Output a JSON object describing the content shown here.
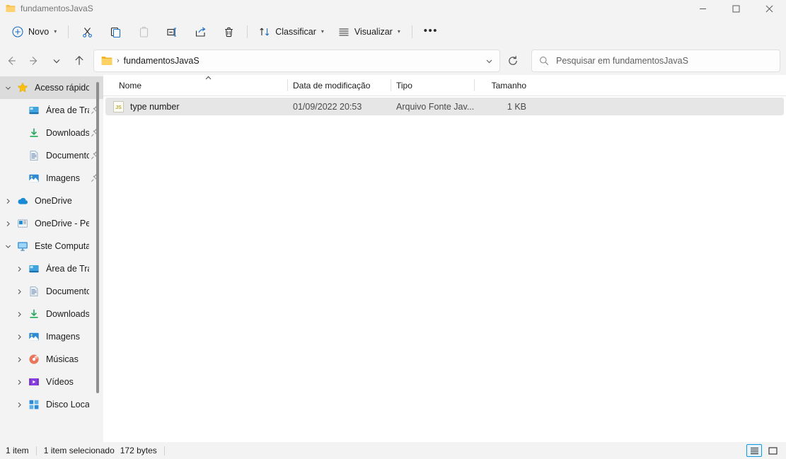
{
  "window": {
    "tab_title": "fundamentosJavaS",
    "tab_icon": "folder-icon",
    "minimize_label": "—",
    "maximize_label": "☐",
    "close_label": "✕"
  },
  "toolbar": {
    "new_label": "Novo",
    "new_icon": "plus-circle-icon",
    "cut_icon": "scissors-icon",
    "copy_icon": "copy-icon",
    "paste_icon": "paste-icon",
    "rename_icon": "rename-icon",
    "share_icon": "share-icon",
    "delete_icon": "trash-icon",
    "sort_label": "Classificar",
    "sort_icon": "sort-arrows-icon",
    "view_label": "Visualizar",
    "view_icon": "list-lines-icon",
    "more_label": "•••"
  },
  "addressbar": {
    "back_icon": "arrow-left-icon",
    "forward_icon": "arrow-right-icon",
    "recent_icon": "chevron-down-icon",
    "up_icon": "arrow-up-icon",
    "breadcrumb_icon": "folder-icon",
    "breadcrumb_separator": "›",
    "breadcrumb_text": "fundamentosJavaS",
    "refresh_icon": "refresh-icon",
    "search_icon": "search-icon",
    "search_placeholder": "Pesquisar em fundamentosJavaS",
    "search_value": ""
  },
  "sidebar": {
    "items": [
      {
        "label": "Acesso rápido",
        "icon": "star-icon",
        "expander": "chevron-down",
        "pinned": false,
        "indent": 0,
        "selected": true
      },
      {
        "label": "Área de Trab",
        "icon": "desktop-icon",
        "expander": "",
        "pinned": true,
        "indent": 1,
        "selected": false
      },
      {
        "label": "Downloads",
        "icon": "download-icon",
        "expander": "",
        "pinned": true,
        "indent": 1,
        "selected": false
      },
      {
        "label": "Documento",
        "icon": "documents-icon",
        "expander": "",
        "pinned": true,
        "indent": 1,
        "selected": false
      },
      {
        "label": "Imagens",
        "icon": "pictures-icon",
        "expander": "",
        "pinned": true,
        "indent": 1,
        "selected": false
      },
      {
        "label": "OneDrive",
        "icon": "onedrive-cloud-icon",
        "expander": "chevron-right",
        "pinned": false,
        "indent": 0,
        "selected": false
      },
      {
        "label": "OneDrive - Perso",
        "icon": "onedrive-personal-icon",
        "expander": "chevron-right",
        "pinned": false,
        "indent": 0,
        "selected": false
      },
      {
        "label": "Este Computado",
        "icon": "this-pc-icon",
        "expander": "chevron-down",
        "pinned": false,
        "indent": 0,
        "selected": false
      },
      {
        "label": "Área de Trabalh",
        "icon": "desktop-icon",
        "expander": "chevron-right",
        "pinned": false,
        "indent": 1,
        "selected": false
      },
      {
        "label": "Documentos",
        "icon": "documents-icon",
        "expander": "chevron-right",
        "pinned": false,
        "indent": 1,
        "selected": false
      },
      {
        "label": "Downloads",
        "icon": "download-icon",
        "expander": "chevron-right",
        "pinned": false,
        "indent": 1,
        "selected": false
      },
      {
        "label": "Imagens",
        "icon": "pictures-icon",
        "expander": "chevron-right",
        "pinned": false,
        "indent": 1,
        "selected": false
      },
      {
        "label": "Músicas",
        "icon": "music-icon",
        "expander": "chevron-right",
        "pinned": false,
        "indent": 1,
        "selected": false
      },
      {
        "label": "Vídeos",
        "icon": "videos-icon",
        "expander": "chevron-right",
        "pinned": false,
        "indent": 1,
        "selected": false
      },
      {
        "label": "Disco Local (C:)",
        "icon": "drive-icon",
        "expander": "chevron-right",
        "pinned": false,
        "indent": 1,
        "selected": false
      }
    ]
  },
  "filelist": {
    "columns": [
      {
        "key": "name",
        "label": "Nome",
        "sorted": "asc"
      },
      {
        "key": "date",
        "label": "Data de modificação",
        "sorted": ""
      },
      {
        "key": "type",
        "label": "Tipo",
        "sorted": ""
      },
      {
        "key": "size",
        "label": "Tamanho",
        "sorted": ""
      }
    ],
    "sort_indicator": "˄",
    "rows": [
      {
        "name": "type number",
        "date": "01/09/2022 20:53",
        "type": "Arquivo Fonte Jav...",
        "size": "1 KB",
        "icon": "js-file-icon",
        "icon_text": "JS",
        "selected": true
      }
    ]
  },
  "statusbar": {
    "item_count": "1 item",
    "selection": "1 item selecionado",
    "selection_size": "172 bytes",
    "details_view_icon": "details-view-icon",
    "large_icons_view_icon": "large-icons-view-icon",
    "active_view": "details"
  },
  "colors": {
    "accent": "#0f9ae0",
    "chrome": "#f3f3f3",
    "pane": "#ffffff",
    "selection": "#e6e6e6",
    "folder_yellow": "#fbc55a"
  }
}
